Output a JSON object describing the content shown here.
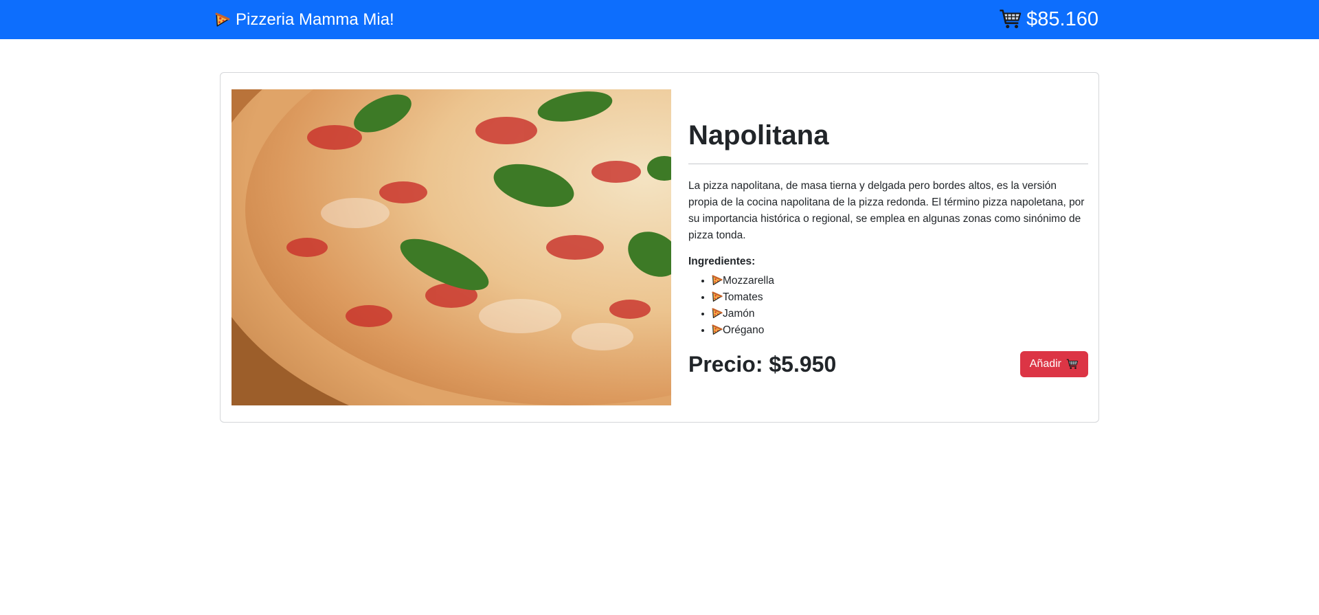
{
  "navbar": {
    "brand_label": "Pizzeria Mamma Mia!",
    "brand_icon": "pizza-slice-icon",
    "cart_icon": "shopping-cart-icon",
    "cart_total": "$85.160",
    "bg_color": "#0d6efd"
  },
  "pizza": {
    "name": "Napolitana",
    "description": "La pizza napolitana, de masa tierna y delgada pero bordes altos, es la versión propia de la cocina napolitana de la pizza redonda. El término pizza napoletana, por su importancia histórica o regional, se emplea en algunas zonas como sinónimo de pizza tonda.",
    "ingredients_title": "Ingredientes:",
    "ingredients": [
      "Mozzarella",
      "Tomates",
      "Jamón",
      "Orégano"
    ],
    "price": "Precio: $5.950",
    "add_button_label": "Añadir",
    "add_button_icon": "shopping-cart-icon",
    "add_button_color": "#dc3545"
  }
}
